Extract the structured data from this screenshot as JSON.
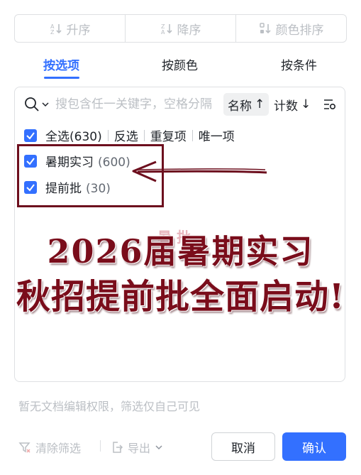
{
  "sort_buttons": [
    {
      "label": "升序",
      "icon": "sort-ascending-icon"
    },
    {
      "label": "降序",
      "icon": "sort-descending-icon"
    },
    {
      "label": "颜色排序",
      "icon": "color-sort-icon"
    }
  ],
  "tabs": [
    {
      "label": "按选项",
      "active": true
    },
    {
      "label": "按颜色",
      "active": false
    },
    {
      "label": "按条件",
      "active": false
    }
  ],
  "search": {
    "placeholder": "搜包含任一关键字，空格分隔",
    "name_sort_label": "名称",
    "name_sort_arrow": "↑",
    "count_sort_label": "计数",
    "count_sort_arrow": "↓"
  },
  "select_all": {
    "label": "全选(630)",
    "links": [
      "反选",
      "重复项",
      "唯一项"
    ]
  },
  "items": [
    {
      "label": "暑期实习",
      "count": "(600)",
      "checked": true
    },
    {
      "label": "提前批",
      "count": "(30)",
      "checked": true
    }
  ],
  "annotation": {
    "line1": "2026届暑期实习",
    "line2": "秋招提前批全面启动!",
    "watermark": "暑 批",
    "color": "#7a0d1b"
  },
  "footer": {
    "notice": "暂无文档编辑权限，筛选仅自己可见",
    "clear_filter": "清除筛选",
    "export": "导出",
    "cancel": "取消",
    "confirm": "确认"
  },
  "colors": {
    "accent": "#3370ff",
    "disabled": "#bbbfc4"
  }
}
